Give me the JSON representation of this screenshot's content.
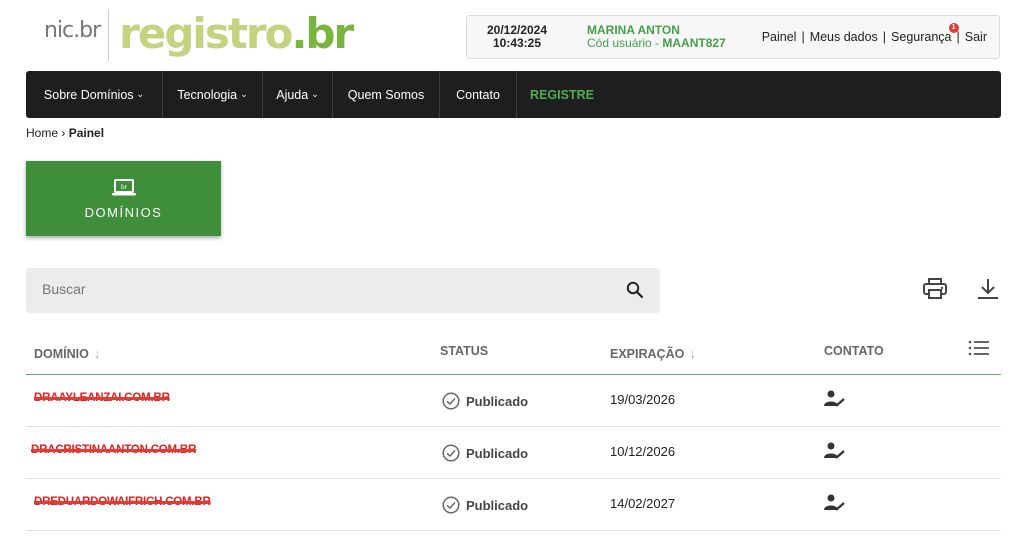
{
  "brand": {
    "nic": "nic.br",
    "registro_main": "registro",
    "registro_suffix": ".br"
  },
  "user_box": {
    "date": "20/12/2024",
    "time": "10:43:25",
    "name": "MARINA ANTON",
    "code_prefix": "Cód usuário - ",
    "code": "MAANT827",
    "links": {
      "painel": "Painel",
      "meus_dados": "Meus dados",
      "seguranca": "Segurança",
      "sair": "Sair"
    },
    "security_badge": "1"
  },
  "nav": {
    "items": [
      {
        "label": "Sobre Domínios",
        "has_dropdown": true
      },
      {
        "label": "Tecnologia",
        "has_dropdown": true
      },
      {
        "label": "Ajuda",
        "has_dropdown": true
      },
      {
        "label": "Quem Somos",
        "has_dropdown": false
      },
      {
        "label": "Contato",
        "has_dropdown": false
      },
      {
        "label": "REGISTRE",
        "has_dropdown": false
      }
    ],
    "chevron": "⌄",
    "accent": "#4caf50"
  },
  "breadcrumb": {
    "home": "Home",
    "separator": "›",
    "current": "Painel"
  },
  "domains_card": {
    "label": "DOMÍNIOS",
    "icon": "laptop-icon",
    "color": "#3f8f3a"
  },
  "search": {
    "placeholder": "Buscar",
    "value": ""
  },
  "toolbar": {
    "print_icon": "print-icon",
    "download_icon": "download-icon"
  },
  "table": {
    "columns": {
      "domain": "DOMÍNIO",
      "status": "STATUS",
      "expiration": "EXPIRAÇÃO",
      "contact": "CONTATO"
    },
    "sort_arrow": "↓",
    "rows": [
      {
        "domain": "DRAAYLEANZAI.COM.BR",
        "status": "Publicado",
        "expiration": "19/03/2026"
      },
      {
        "domain": "DRACRISTINAANTON.COM.BR",
        "status": "Publicado",
        "expiration": "10/12/2026"
      },
      {
        "domain": "DREDUARDOWAIFRICH.COM.BR",
        "status": "Publicado",
        "expiration": "14/02/2027"
      }
    ]
  }
}
